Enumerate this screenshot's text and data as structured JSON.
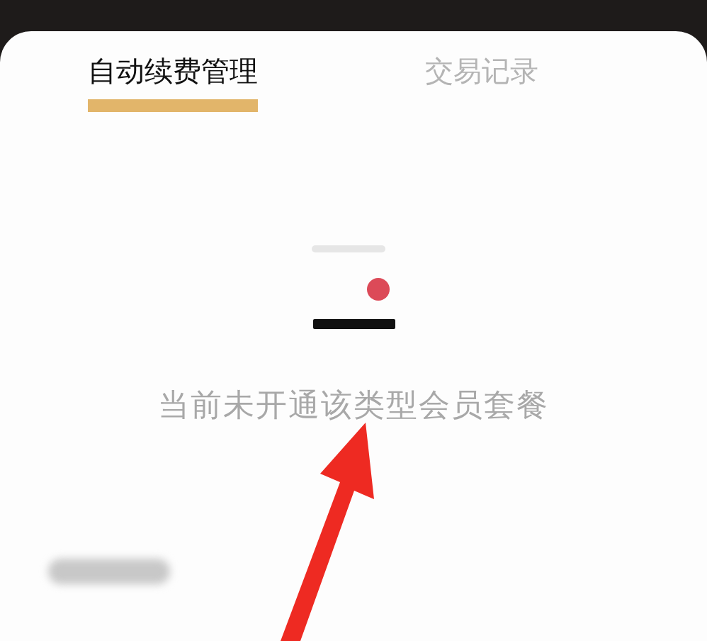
{
  "tabs": [
    {
      "label": "自动续费管理",
      "selected": true
    },
    {
      "label": "交易记录",
      "selected": false
    }
  ],
  "empty_state": {
    "message": "当前未开通该类型会员套餐"
  }
}
